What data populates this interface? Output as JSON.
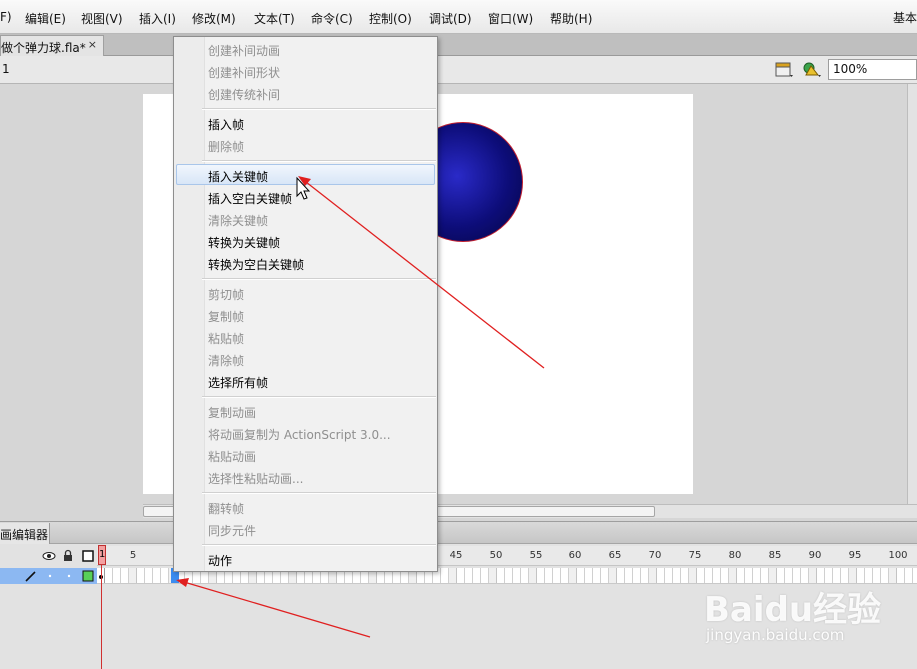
{
  "menubar": {
    "items": [
      "F)",
      "编辑(E)",
      "视图(V)",
      "插入(I)",
      "修改(M)",
      "文本(T)",
      "命令(C)",
      "控制(O)",
      "调试(D)",
      "窗口(W)",
      "帮助(H)"
    ],
    "workspace": "基本"
  },
  "document": {
    "tab_label": "做个弹力球.fla*",
    "close_symbol": "×"
  },
  "editbar": {
    "scene": "1",
    "zoom": "100%"
  },
  "timeline": {
    "tab_label": "画编辑器",
    "ruler": [
      "5",
      "45",
      "50",
      "55",
      "60",
      "65",
      "70",
      "75",
      "80",
      "85",
      "90",
      "95",
      "100"
    ],
    "playhead": "1",
    "selected_frame": 10
  },
  "context_menu": {
    "items": [
      {
        "label": "创建补间动画",
        "enabled": false
      },
      {
        "label": "创建补间形状",
        "enabled": false
      },
      {
        "label": "创建传统补间",
        "enabled": false
      },
      {
        "label": "插入帧",
        "enabled": true
      },
      {
        "label": "删除帧",
        "enabled": false
      },
      {
        "label": "插入关键帧",
        "enabled": true,
        "highlighted": true
      },
      {
        "label": "插入空白关键帧",
        "enabled": true
      },
      {
        "label": "清除关键帧",
        "enabled": false
      },
      {
        "label": "转换为关键帧",
        "enabled": true
      },
      {
        "label": "转换为空白关键帧",
        "enabled": true
      },
      {
        "label": "剪切帧",
        "enabled": false
      },
      {
        "label": "复制帧",
        "enabled": false
      },
      {
        "label": "粘贴帧",
        "enabled": false
      },
      {
        "label": "清除帧",
        "enabled": false
      },
      {
        "label": "选择所有帧",
        "enabled": true
      },
      {
        "label": "复制动画",
        "enabled": false
      },
      {
        "label": "将动画复制为 ActionScript 3.0...",
        "enabled": false
      },
      {
        "label": "粘贴动画",
        "enabled": false
      },
      {
        "label": "选择性粘贴动画...",
        "enabled": false
      },
      {
        "label": "翻转帧",
        "enabled": false
      },
      {
        "label": "同步元件",
        "enabled": false
      },
      {
        "label": "动作",
        "enabled": true
      }
    ]
  },
  "watermark": {
    "logo": "Baidu经验",
    "url": "jingyan.baidu.com"
  },
  "colors": {
    "annotation_arrow": "#e02020",
    "menu_highlight": "#d8e6f7",
    "layer_row": "#8cb8f2",
    "selected_frame": "#3b8cf0"
  }
}
